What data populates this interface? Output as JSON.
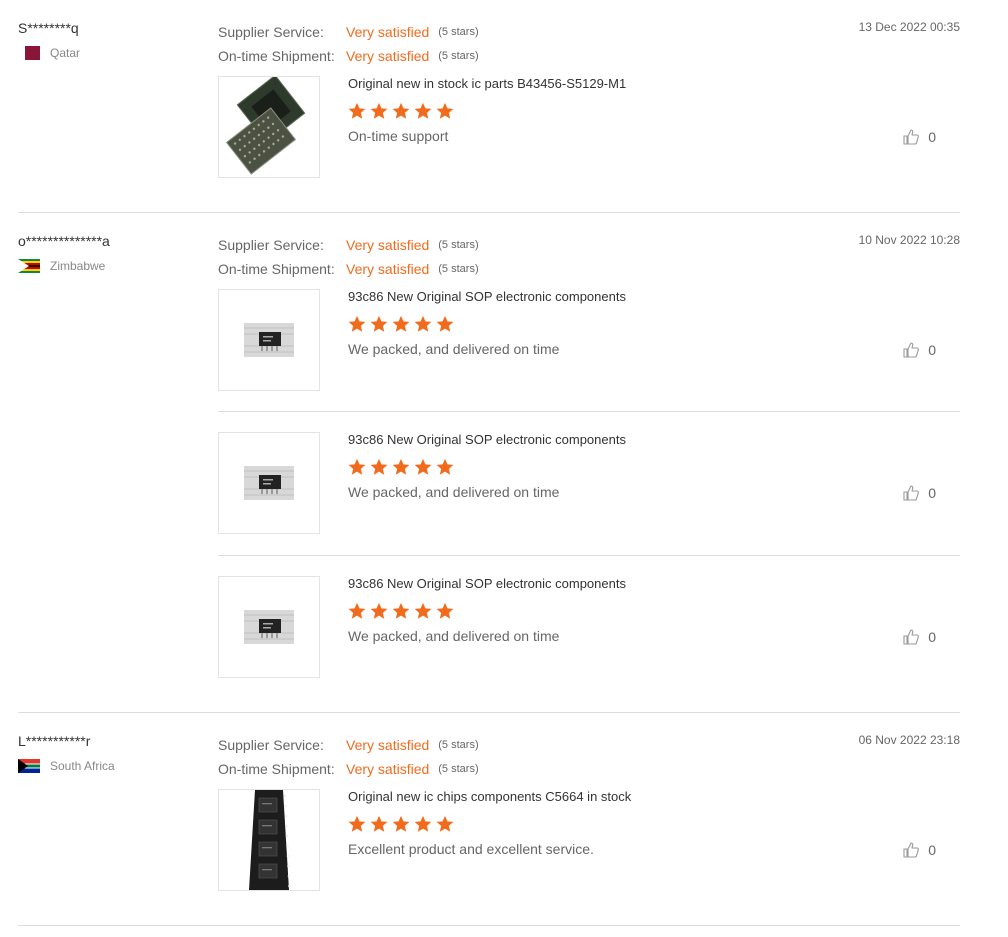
{
  "colors": {
    "accent": "#f26b1d",
    "divider": "#dcdcdc",
    "muted_text": "#666666"
  },
  "reviews": [
    {
      "buyer": "S********q",
      "country": "Qatar",
      "flag": "qatar-flag-icon",
      "date": "13 Dec 2022 00:35",
      "supplier_label": "Supplier Service:",
      "supplier_value": "Very satisfied",
      "supplier_stars": "(5 stars)",
      "shipment_label": "On-time Shipment:",
      "shipment_value": "Very satisfied",
      "shipment_stars": "(5 stars)",
      "products": [
        {
          "title": "Original new in stock ic parts B43456-S5129-M1",
          "rating": 5,
          "comment": "On-time support",
          "likes": "0",
          "image": "bga-chip-image"
        }
      ]
    },
    {
      "buyer": "o**************a",
      "country": "Zimbabwe",
      "flag": "zimbabwe-flag-icon",
      "date": "10 Nov 2022 10:28",
      "supplier_label": "Supplier Service:",
      "supplier_value": "Very satisfied",
      "supplier_stars": "(5 stars)",
      "shipment_label": "On-time Shipment:",
      "shipment_value": "Very satisfied",
      "shipment_stars": "(5 stars)",
      "products": [
        {
          "title": "93c86 New Original SOP electronic components",
          "rating": 5,
          "comment": "We packed, and delivered on time",
          "likes": "0",
          "image": "sop-chip-image"
        },
        {
          "title": "93c86 New Original SOP electronic components",
          "rating": 5,
          "comment": "We packed, and delivered on time",
          "likes": "0",
          "image": "sop-chip-image"
        },
        {
          "title": "93c86 New Original SOP electronic components",
          "rating": 5,
          "comment": "We packed, and delivered on time",
          "likes": "0",
          "image": "sop-chip-image"
        }
      ]
    },
    {
      "buyer": "L***********r",
      "country": "South Africa",
      "flag": "south-africa-flag-icon",
      "date": "06 Nov 2022 23:18",
      "supplier_label": "Supplier Service:",
      "supplier_value": "Very satisfied",
      "supplier_stars": "(5 stars)",
      "shipment_label": "On-time Shipment:",
      "shipment_value": "Very satisfied",
      "shipment_stars": "(5 stars)",
      "products": [
        {
          "title": "Original new ic chips components C5664 in stock",
          "rating": 5,
          "comment": "Excellent product and excellent service.",
          "likes": "0",
          "image": "chip-tape-image"
        }
      ]
    }
  ]
}
